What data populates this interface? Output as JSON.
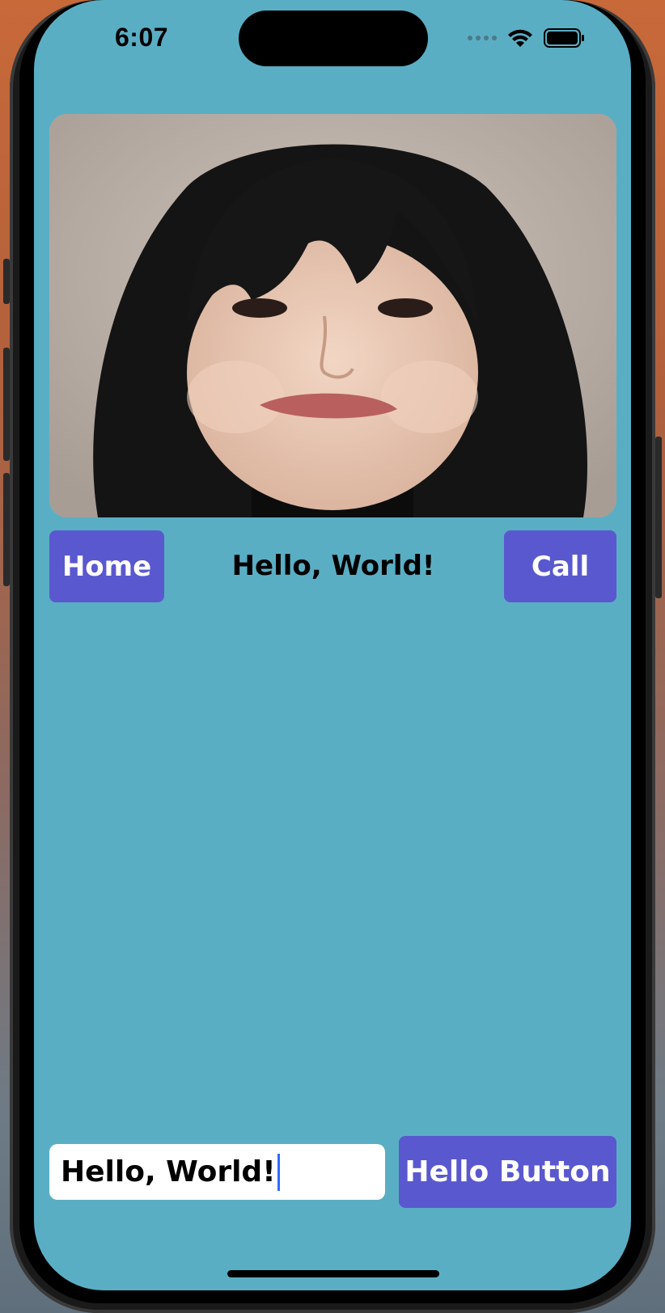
{
  "status_bar": {
    "time": "6:07"
  },
  "header": {
    "photo_alt": ""
  },
  "nav": {
    "home_label": "Home",
    "title": "Hello, World!",
    "call_label": "Call"
  },
  "form": {
    "input_value": "Hello, World!",
    "button_label": "Hello Button"
  },
  "colors": {
    "screen_bg": "#5aaec4",
    "button_bg": "#5a58cf",
    "caret": "#2f6bff"
  }
}
